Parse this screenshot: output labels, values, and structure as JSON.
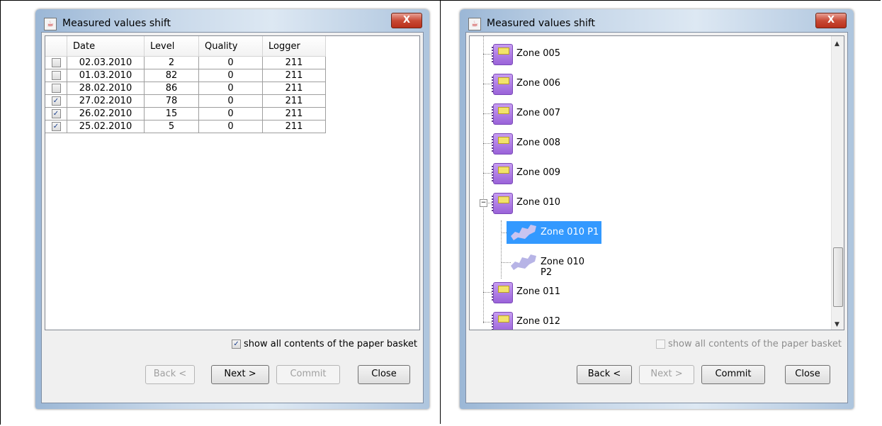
{
  "left_window": {
    "title": "Measured values shift",
    "close_glyph": "X",
    "columns": [
      "",
      "Date",
      "Level",
      "Quality",
      "Logger"
    ],
    "rows": [
      {
        "checked": false,
        "date": "02.03.2010",
        "level": "2",
        "quality": "0",
        "logger": "211"
      },
      {
        "checked": false,
        "date": "01.03.2010",
        "level": "82",
        "quality": "0",
        "logger": "211"
      },
      {
        "checked": false,
        "date": "28.02.2010",
        "level": "86",
        "quality": "0",
        "logger": "211"
      },
      {
        "checked": true,
        "date": "27.02.2010",
        "level": "78",
        "quality": "0",
        "logger": "211"
      },
      {
        "checked": true,
        "date": "26.02.2010",
        "level": "15",
        "quality": "0",
        "logger": "211"
      },
      {
        "checked": true,
        "date": "25.02.2010",
        "level": "5",
        "quality": "0",
        "logger": "211"
      }
    ],
    "basket_label": "show all contents of the paper basket",
    "basket_checked": true,
    "buttons": {
      "back": "Back <",
      "next": "Next >",
      "commit": "Commit",
      "close": "Close"
    }
  },
  "right_window": {
    "title": "Measured values shift",
    "close_glyph": "X",
    "tree": [
      {
        "label": "Zone 005",
        "kind": "notebook"
      },
      {
        "label": "Zone 006",
        "kind": "notebook"
      },
      {
        "label": "Zone 007",
        "kind": "notebook"
      },
      {
        "label": "Zone 008",
        "kind": "notebook"
      },
      {
        "label": "Zone 009",
        "kind": "notebook"
      },
      {
        "label": "Zone 010",
        "kind": "notebook",
        "expanded": true
      },
      {
        "label": "Zone 010 P1",
        "kind": "part",
        "selected": true
      },
      {
        "label": "Zone 010 P2",
        "kind": "part"
      },
      {
        "label": "Zone 011",
        "kind": "notebook"
      },
      {
        "label": "Zone 012",
        "kind": "notebook"
      }
    ],
    "basket_label": "show all contents of the paper basket",
    "basket_checked": false,
    "buttons": {
      "back": "Back <",
      "next": "Next >",
      "commit": "Commit",
      "close": "Close"
    }
  },
  "colors": {
    "selection": "#3399ff",
    "notebook": "#a874e3",
    "part": "#b7b4e6"
  }
}
